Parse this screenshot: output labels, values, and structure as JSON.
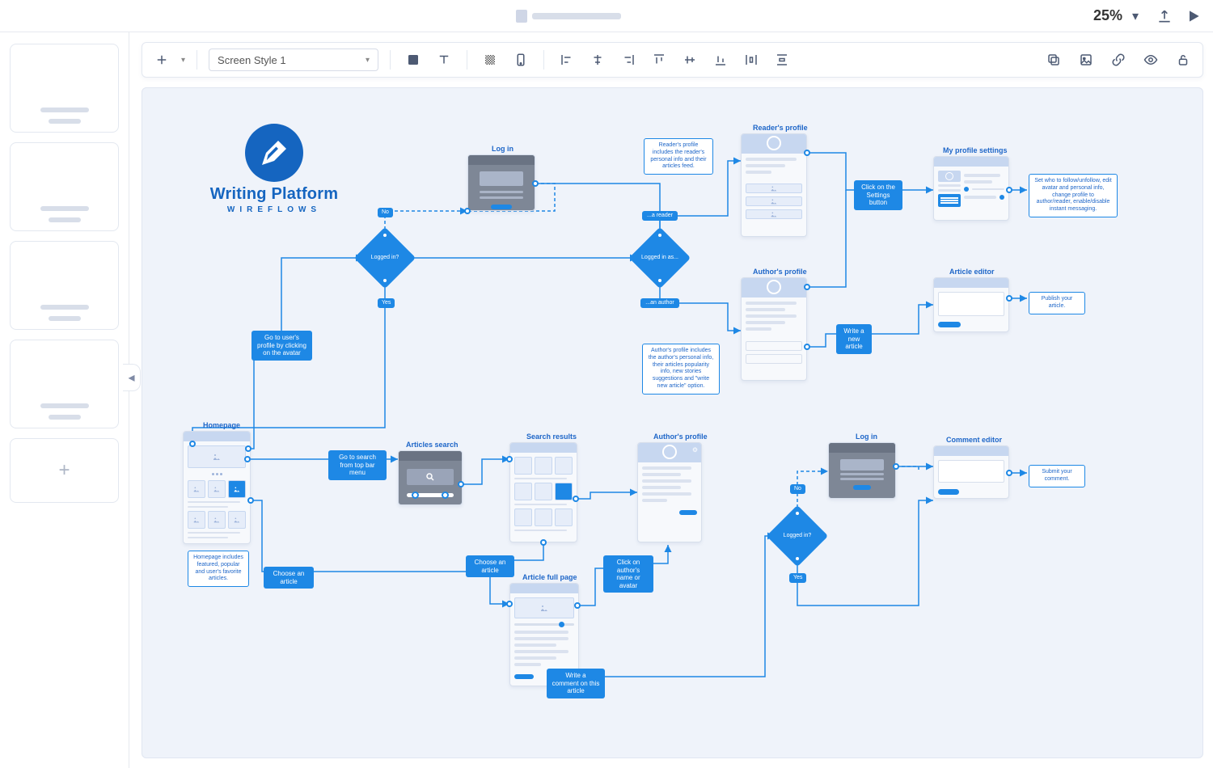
{
  "titlebar": {
    "zoom_label": "25%"
  },
  "toolbar": {
    "style_select_label": "Screen Style 1"
  },
  "logo": {
    "title": "Writing Platform",
    "subtitle": "WIREFLOWS"
  },
  "screens": {
    "login_top": "Log in",
    "readers_profile": "Reader's profile",
    "profile_settings": "My profile settings",
    "authors_profile": "Author's profile",
    "article_editor": "Article editor",
    "homepage": "Homepage",
    "articles_search": "Articles search",
    "search_results": "Search results",
    "authors_profile2": "Author's profile",
    "login_bottom": "Log in",
    "comment_editor": "Comment editor",
    "article_full": "Article full page"
  },
  "decisions": {
    "logged_in": "Logged in?",
    "logged_in_as": "Logged in as...",
    "logged_in2": "Logged in?"
  },
  "branches": {
    "no": "No",
    "yes": "Yes",
    "reader": "...a reader",
    "author": "...an author"
  },
  "actions": {
    "goto_profile": "Go to user's profile by clicking on the avatar",
    "settings_btn": "Click on the Settings button",
    "write_article": "Write a new article",
    "goto_search": "Go to search from top bar menu",
    "choose_article1": "Choose an article",
    "choose_article2": "Choose an article",
    "click_author": "Click on author's name or avatar",
    "write_comment": "Write a comment on this article"
  },
  "tips": {
    "reader_profile": "Reader's profile includes the reader's personal info and their articles feed.",
    "author_profile": "Author's profile includes the author's personal info, their articles popularity info, new stories suggestions and \"write new article\" option.",
    "profile_settings": "Set who to follow/unfollow, edit avatar and personal info, change profile to author/reader, enable/disable instant messaging.",
    "publish": "Publish your article.",
    "homepage": "Homepage includes featured, popular and user's favorite articles.",
    "submit_comment": "Submit your comment."
  }
}
